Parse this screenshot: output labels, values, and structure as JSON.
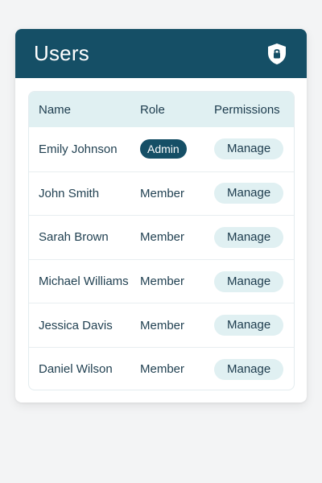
{
  "header": {
    "title": "Users",
    "icon": "shield-lock-icon"
  },
  "table": {
    "columns": [
      "Name",
      "Role",
      "Permissions"
    ],
    "rows": [
      {
        "name": "Emily Johnson",
        "role": "Admin",
        "action": "Manage"
      },
      {
        "name": "John Smith",
        "role": "Member",
        "action": "Manage"
      },
      {
        "name": "Sarah Brown",
        "role": "Member",
        "action": "Manage"
      },
      {
        "name": "Michael Williams",
        "role": "Member",
        "action": "Manage"
      },
      {
        "name": "Jessica Davis",
        "role": "Member",
        "action": "Manage"
      },
      {
        "name": "Daniel Wilson",
        "role": "Member",
        "action": "Manage"
      }
    ]
  },
  "colors": {
    "accent": "#154f66",
    "header_row_bg": "#e0f0f2",
    "button_bg": "#e0f0f2",
    "page_bg": "#f3f4f5"
  }
}
